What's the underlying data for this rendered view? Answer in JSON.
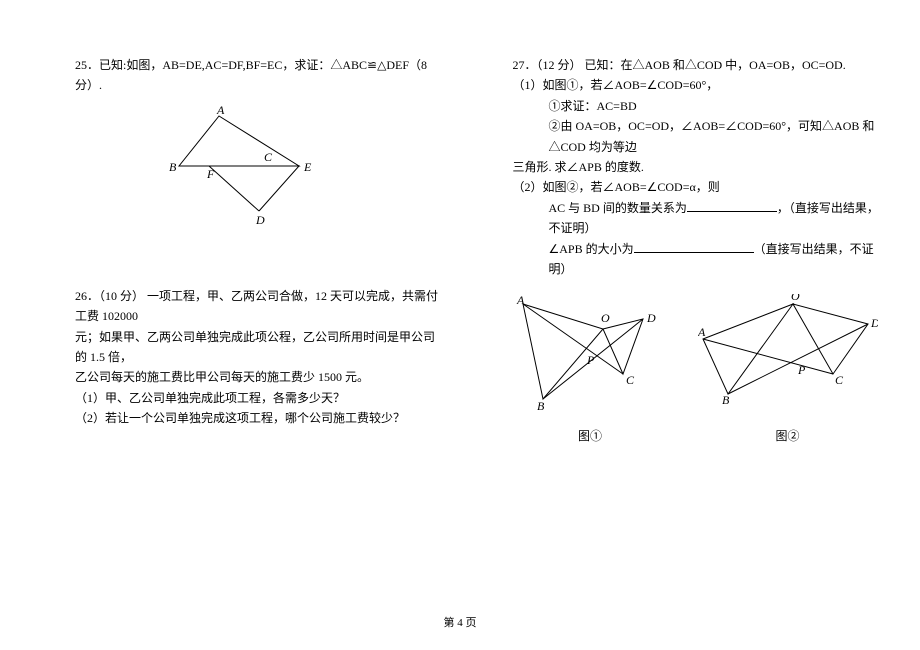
{
  "footer": "第 4 页",
  "p25": {
    "text": "25．已知:如图，AB=DE,AC=DF,BF=EC，求证：△ABC≌△DEF（8 分）.",
    "labels": {
      "A": "A",
      "B": "B",
      "C": "C",
      "D": "D",
      "E": "E",
      "F": "F"
    }
  },
  "p26": {
    "l1": "26．（10 分）  一项工程，甲、乙两公司合做，12 天可以完成，共需付工费 102000",
    "l2": "元；如果甲、乙两公司单独完成此项公程，乙公司所用时间是甲公司的 1.5 倍，",
    "l3": "乙公司每天的施工费比甲公司每天的施工费少 1500 元。",
    "l4": "（1）甲、乙公司单独完成此项工程，各需多少天？",
    "l5": "（2）若让一个公司单独完成这项工程，哪个公司施工费较少？"
  },
  "p27": {
    "l1": "27．（12 分）  已知：在△AOB 和△COD 中，OA=OB，OC=OD.",
    "l2": "（1）如图①，若∠AOB=∠COD=60°，",
    "l3": "①求证：AC=BD",
    "l4": "②由 OA=OB，OC=OD，∠AOB=∠COD=60°，可知△AOB 和△COD 均为等边",
    "l5": "三角形. 求∠APB 的度数.",
    "l6": "（2）如图②，若∠AOB=∠COD=α，则",
    "l7a": "AC 与 BD 间的数量关系为",
    "l7b": "，（直接写出结果，不证明）",
    "l8a": "∠APB 的大小为",
    "l8b": "（直接写出结果，不证明）",
    "fig1_label": "图①",
    "fig2_label": "图②",
    "labels": {
      "A": "A",
      "B": "B",
      "C": "C",
      "D": "D",
      "O": "O",
      "P": "P"
    }
  }
}
